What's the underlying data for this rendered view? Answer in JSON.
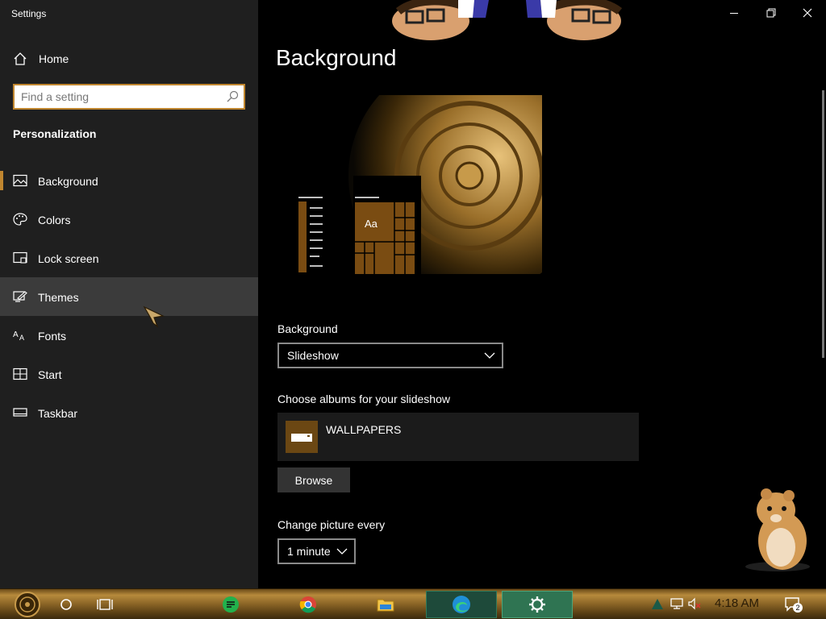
{
  "window": {
    "title": "Settings"
  },
  "sidebar": {
    "home_label": "Home",
    "search_placeholder": "Find a setting",
    "section_title": "Personalization",
    "items": [
      {
        "label": "Background",
        "icon": "picture-icon",
        "selected": true
      },
      {
        "label": "Colors",
        "icon": "palette-icon"
      },
      {
        "label": "Lock screen",
        "icon": "lock-screen-icon"
      },
      {
        "label": "Themes",
        "icon": "brush-icon",
        "hovered": true
      },
      {
        "label": "Fonts",
        "icon": "font-icon"
      },
      {
        "label": "Start",
        "icon": "start-icon"
      },
      {
        "label": "Taskbar",
        "icon": "taskbar-icon"
      }
    ]
  },
  "main": {
    "page_title": "Background",
    "preview": {
      "tile_text": "Aa"
    },
    "background_label": "Background",
    "background_value": "Slideshow",
    "albums_label": "Choose albums for your slideshow",
    "album_name": "WALLPAPERS",
    "browse_label": "Browse",
    "change_label": "Change picture every",
    "change_value": "1 minute"
  },
  "taskbar": {
    "clock": "4:18 AM",
    "notification_count": "2"
  },
  "colors": {
    "accent": "#c0862f",
    "sidebar_bg": "#1f1f1f",
    "main_bg": "#000000"
  }
}
